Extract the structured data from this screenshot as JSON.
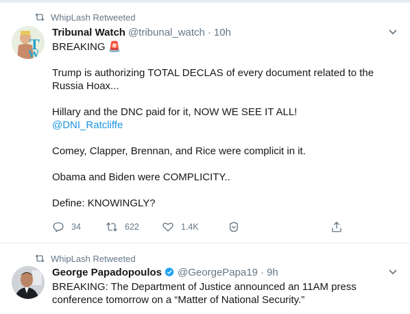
{
  "tweets": [
    {
      "retweet_label": "WhipLash Retweeted",
      "display_name": "Tribunal Watch",
      "handle": "@tribunal_watch",
      "separator": "·",
      "time": "10h",
      "verified": false,
      "paragraphs": [
        {
          "text": "BREAKING 🚨"
        },
        {
          "text": ""
        },
        {
          "text": "Trump is authorizing TOTAL DECLAS of every document related to the Russia Hoax..."
        },
        {
          "text": ""
        },
        {
          "text": "Hillary and the DNC paid for it, NOW WE SEE IT ALL!"
        },
        {
          "link": "@DNI_Ratcliffe"
        },
        {
          "text": ""
        },
        {
          "text": "Comey, Clapper, Brennan, and Rice were complicit in it."
        },
        {
          "text": ""
        },
        {
          "text": "Obama and Biden were COMPLICITY.."
        },
        {
          "text": ""
        },
        {
          "text": "Define: KNOWINGLY?"
        }
      ],
      "actions": {
        "replies": "34",
        "retweets": "622",
        "likes": "1.4K"
      }
    },
    {
      "retweet_label": "WhipLash Retweeted",
      "display_name": "George Papadopoulos",
      "handle": "@GeorgePapa19",
      "separator": "·",
      "time": "9h",
      "verified": true,
      "paragraphs": [
        {
          "text": "BREAKING: The Department of Justice announced an 11AM press conference tomorrow on a “Matter of National Security.”"
        }
      ]
    }
  ],
  "colors": {
    "text": "#14171a",
    "muted": "#657786",
    "link": "#1b95e0",
    "verified": "#1da1f2",
    "divider": "#e6ecf0"
  }
}
